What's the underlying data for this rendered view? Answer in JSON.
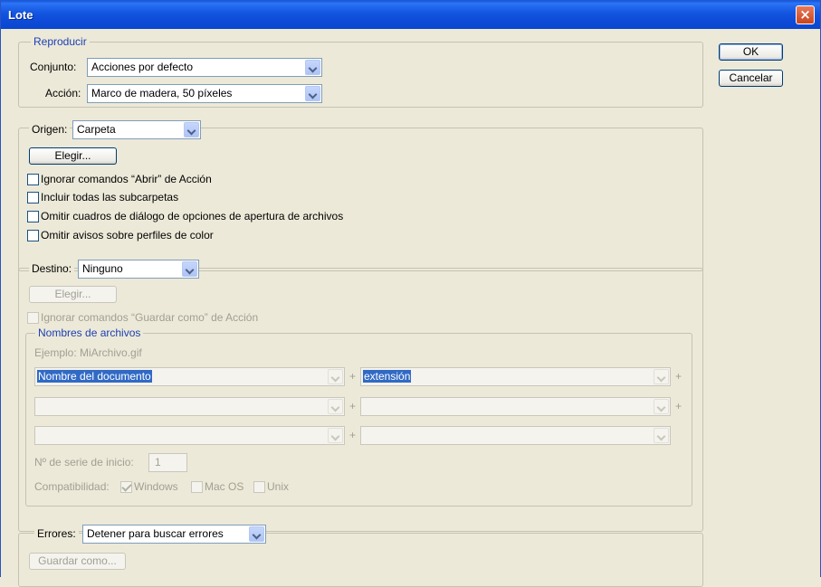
{
  "window": {
    "title": "Lote",
    "close_glyph": "×"
  },
  "buttons": {
    "ok": "OK",
    "cancel": "Cancelar"
  },
  "play": {
    "legend": "Reproducir",
    "set_label": "Conjunto:",
    "set_value": "Acciones por defecto",
    "action_label": "Acción:",
    "action_value": "Marco de madera, 50 píxeles"
  },
  "source": {
    "label": "Origen:",
    "value": "Carpeta",
    "choose": "Elegir...",
    "options": [
      "Ignorar comandos “Abrir” de Acción",
      "Incluir todas las subcarpetas",
      "Omitir cuadros de diálogo de opciones de apertura de archivos",
      "Omitir avisos sobre perfiles de color"
    ]
  },
  "destination": {
    "label": "Destino:",
    "value": "Ninguno",
    "choose": "Elegir...",
    "ignore_save_as": "Ignorar comandos “Guardar como” de Acción",
    "file_naming": {
      "legend": "Nombres de archivos",
      "example": "Ejemplo: MiArchivo.gif",
      "rows": [
        {
          "left": "Nombre del documento",
          "right": "extensión",
          "plus": "+",
          "right_plus": "+"
        },
        {
          "left": "",
          "right": "",
          "plus": "+",
          "right_plus": "+"
        },
        {
          "left": "",
          "right": "",
          "plus": "+"
        }
      ],
      "serial_label": "Nº de serie de inicio:",
      "serial_value": "1",
      "compat_label": "Compatibilidad:",
      "compat": [
        {
          "label": "Windows",
          "checked": true
        },
        {
          "label": "Mac OS",
          "checked": false
        },
        {
          "label": "Unix",
          "checked": false
        }
      ]
    }
  },
  "errors": {
    "label": "Errores:",
    "value": "Detener para buscar errores",
    "save_as": "Guardar como..."
  },
  "colors": {
    "titlebar": "#0a54e3",
    "legend_blue": "#1c3fb4",
    "highlight": "#316ac5",
    "dialog_bg": "#ece9d8"
  },
  "icons": {
    "close": "close-icon",
    "dropdown": "chevron-down-icon"
  }
}
